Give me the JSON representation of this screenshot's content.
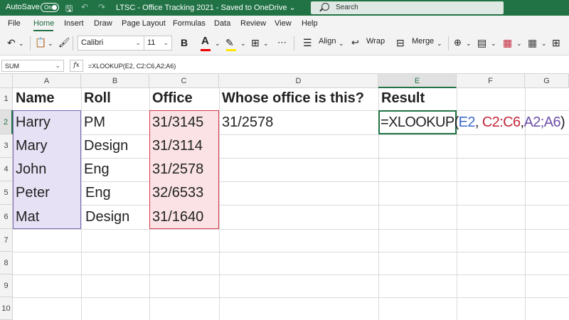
{
  "titlebar": {
    "autosave_label": "AutoSave",
    "autosave_state": "On",
    "title": "LTSC - Office Tracking 2021 - Saved to OneDrive",
    "title_caret": "⌄",
    "search_placeholder": "Search"
  },
  "menu": {
    "tabs": [
      "File",
      "Home",
      "Insert",
      "Draw",
      "Page Layout",
      "Formulas",
      "Data",
      "Review",
      "View",
      "Help"
    ],
    "active_tab": "Home"
  },
  "ribbon": {
    "font_name": "Calibri",
    "font_size": "11",
    "bold_label": "B",
    "font_color_label": "A",
    "align_label": "Align",
    "wrap_label": "Wrap",
    "merge_label": "Merge"
  },
  "formula_bar": {
    "name_box": "SUM",
    "fx_label": "fx",
    "formula": "=XLOOKUP(E2, C2:C6,A2;A6)"
  },
  "grid": {
    "columns": [
      "A",
      "B",
      "C",
      "D",
      "E",
      "F",
      "G"
    ],
    "rows": [
      "1",
      "2",
      "3",
      "4",
      "5",
      "6",
      "7",
      "8",
      "9",
      "10"
    ],
    "header": {
      "a": "Name",
      "b": "Roll",
      "c": "Office",
      "d": "Whose office is this?",
      "e": "Result"
    },
    "data": [
      {
        "name": "Harry",
        "roll": "PM",
        "office": "31/3145"
      },
      {
        "name": "Mary",
        "roll": "Design",
        "office": "31/3114"
      },
      {
        "name": "John",
        "roll": "Eng",
        "office": "31/2578"
      },
      {
        "name": "Peter",
        "roll": "Eng",
        "office": "32/6533"
      },
      {
        "name": "Mat",
        "roll": "Design",
        "office": "31/1640"
      }
    ],
    "lookup_value": "31/2578",
    "active_formula": {
      "prefix": "=XLOOKUP(",
      "arg1": "E2",
      "sep1": ", ",
      "arg2": "C2:C6",
      "sep2": ",",
      "arg3": "A2;A6",
      "suffix": ")"
    }
  },
  "colors": {
    "brand": "#217346",
    "range_a": "#7a67b3",
    "range_c": "#d9374b"
  }
}
